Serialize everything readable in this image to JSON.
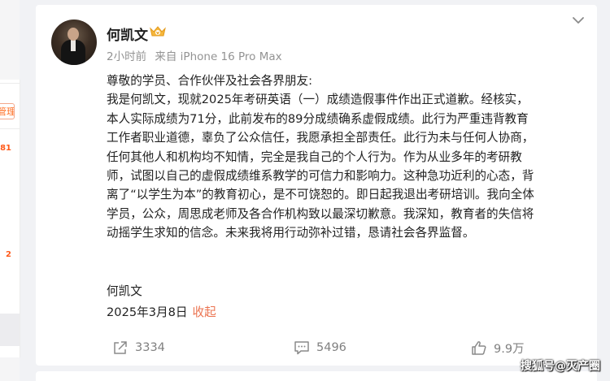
{
  "sidebar": {
    "manage_label": "管理",
    "badge_1": "81",
    "badge_2": "2"
  },
  "post": {
    "author": "何凯文",
    "time": "2小时前",
    "source": "来自 iPhone 16 Pro Max",
    "lines": [
      "尊敬的学员、合作伙伴及社会各界朋友:",
      "我是何凯文，现就2025年考研英语（一）成绩造假事件作出正式道歉。经核实，",
      "本人实际成绩为71分，此前发布的89分成绩确系虚假成绩。此行为严重违背教育",
      "工作者职业道德，辜负了公众信任，我愿承担全部责任。此行为未与任何人协商，",
      "任何其他人和机构均不知情，完全是我自己的个人行为。作为从业多年的考研教",
      "师，试图以自己的虚假成绩维系教学的可信力和影响力。这种急功近利的心态，背",
      "离了“以学生为本”的教育初心，是不可饶恕的。即日起我退出考研培训。我向全体",
      "学员，公众，周思成老师及各合作机构致以最深切歉意。我深知，教育者的失信将",
      "动摇学生求知的信念。未来我将用行动弥补过错，恳请社会各界监督。"
    ],
    "signature": "何凯文",
    "date": "2025年3月8日",
    "collapse_label": "收起"
  },
  "actions": {
    "forward_count": "3334",
    "comment_count": "5496",
    "like_count": "9.9万"
  },
  "watermark": "搜狐号@灭产圈",
  "colors": {
    "accent": "#eb7350",
    "badge": "#ff5a1a",
    "muted": "#939393",
    "background": "#f1f2f5"
  },
  "icons": {
    "verified": "gold-crown-v-badge",
    "more": "chevron-down-icon",
    "forward": "forward-icon",
    "comment": "comment-icon",
    "like": "thumbs-up-icon"
  }
}
